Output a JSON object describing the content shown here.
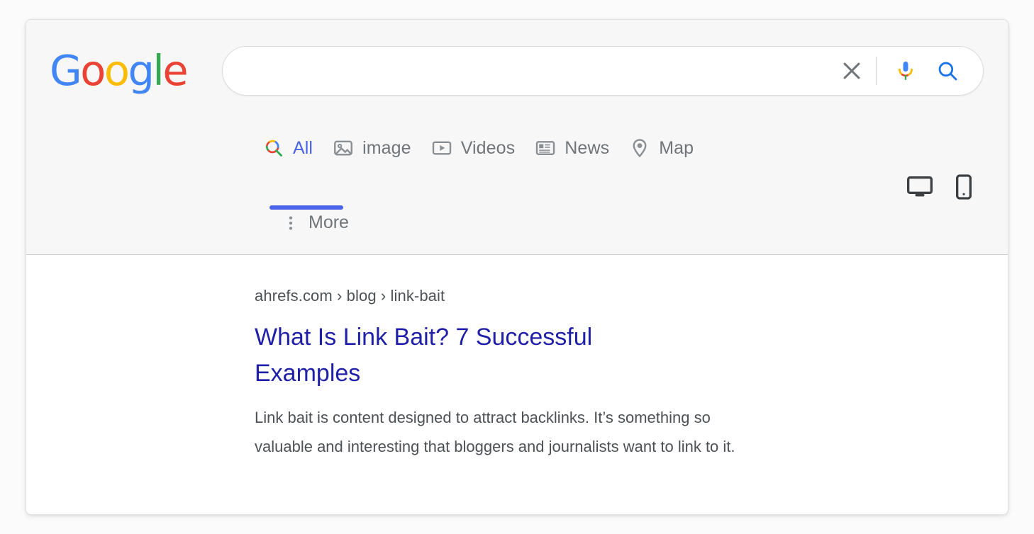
{
  "brand": {
    "logo_letters": [
      {
        "char": "G",
        "color": "#4285f4"
      },
      {
        "char": "o",
        "color": "#ea4335"
      },
      {
        "char": "o",
        "color": "#fbbc05"
      },
      {
        "char": "g",
        "color": "#4285f4"
      },
      {
        "char": "l",
        "color": "#34a853"
      },
      {
        "char": "e",
        "color": "#ea4335"
      }
    ],
    "name": "Google"
  },
  "search": {
    "value": "",
    "placeholder": "",
    "clear_icon": "close-x-icon",
    "mic_icon": "microphone-icon",
    "search_icon": "magnifier-icon"
  },
  "tabs": [
    {
      "label": "All",
      "icon": "colorful-magnifier-icon",
      "active": true
    },
    {
      "label": "image",
      "icon": "photo-icon",
      "active": false
    },
    {
      "label": "Videos",
      "icon": "video-play-icon",
      "active": false
    },
    {
      "label": "News",
      "icon": "newspaper-icon",
      "active": false
    },
    {
      "label": "Map",
      "icon": "map-pin-icon",
      "active": false
    }
  ],
  "more": {
    "label": "More",
    "icon": "kebab-menu-icon"
  },
  "device_toggles": [
    {
      "name": "desktop-view-toggle",
      "icon": "monitor-icon"
    },
    {
      "name": "mobile-view-toggle",
      "icon": "smartphone-icon"
    }
  ],
  "result": {
    "breadcrumb": "ahrefs.com › blog › link-bait",
    "title": "What Is Link Bait? 7 Successful Examples",
    "snippet": "Link bait is content designed to attract backlinks. It’s something so valuable and interesting that bloggers and journalists want to link to it."
  },
  "colors": {
    "accent_blue": "#4a63e7",
    "link_blue": "#1f1fa8",
    "text_gray": "#4d5156",
    "muted_gray": "#70757a",
    "header_bg": "#f7f7f7",
    "page_bg": "#fbfbfb"
  }
}
